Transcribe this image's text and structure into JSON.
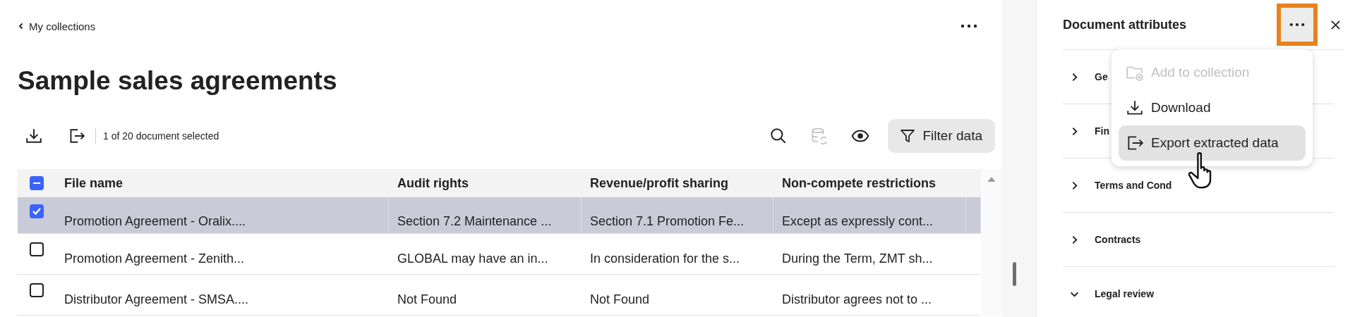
{
  "breadcrumb": {
    "label": "My collections"
  },
  "title": "Sample sales agreements",
  "toolbar": {
    "selection_text": "1 of 20 document selected",
    "refresh_disabled": true,
    "filter_label": "Filter data"
  },
  "table": {
    "select_all_partial": true,
    "columns": [
      "File name",
      "Audit rights",
      "Revenue/profit sharing",
      "Non-compete restrictions"
    ],
    "rows": [
      {
        "selected": true,
        "checked": true,
        "cells": [
          "Promotion Agreement - Oralix....",
          "Section 7.2 Maintenance ...",
          "Section 7.1 Promotion Fe...",
          "Except as expressly cont..."
        ]
      },
      {
        "selected": false,
        "checked": false,
        "cells": [
          "Promotion Agreement - Zenith...",
          "GLOBAL may have an in...",
          "In consideration for the s...",
          "During the Term, ZMT sh..."
        ]
      },
      {
        "selected": false,
        "checked": false,
        "cells": [
          "Distributor Agreement - SMSA....",
          "Not Found",
          "Not Found",
          "Distributor agrees not to ..."
        ]
      }
    ]
  },
  "panel": {
    "title": "Document attributes",
    "more_highlighted": true,
    "sections": [
      {
        "label": "Ge",
        "expanded": false
      },
      {
        "label": "Fin",
        "expanded": false
      },
      {
        "label": "Terms and Cond",
        "expanded": false
      },
      {
        "label": "Contracts",
        "expanded": false
      },
      {
        "label": "Legal review",
        "expanded": true
      }
    ],
    "menu": [
      {
        "kind": "add",
        "label": "Add to collection",
        "disabled": true,
        "selected": false
      },
      {
        "kind": "download",
        "label": "Download",
        "disabled": false,
        "selected": false
      },
      {
        "kind": "export",
        "label": "Export extracted data",
        "disabled": false,
        "selected": true
      }
    ]
  }
}
